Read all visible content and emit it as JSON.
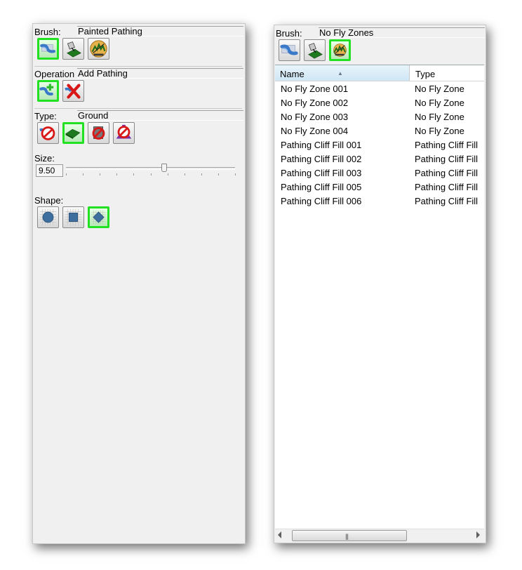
{
  "left_panel": {
    "brush": {
      "label": "Brush:",
      "value": "Painted Pathing"
    },
    "operation": {
      "label": "Operation",
      "value": "Add Pathing"
    },
    "type": {
      "label": "Type:",
      "value": "Ground"
    },
    "size": {
      "label": "Size:",
      "value": "9.50",
      "slider_fraction": 0.58
    },
    "shape": {
      "label": "Shape:"
    }
  },
  "right_panel": {
    "brush": {
      "label": "Brush:",
      "value": "No Fly Zones"
    },
    "list": {
      "columns": [
        "Name",
        "Type"
      ],
      "rows": [
        {
          "name": "No Fly Zone 001",
          "type": "No Fly Zone"
        },
        {
          "name": "No Fly Zone 002",
          "type": "No Fly Zone"
        },
        {
          "name": "No Fly Zone 003",
          "type": "No Fly Zone"
        },
        {
          "name": "No Fly Zone 004",
          "type": "No Fly Zone"
        },
        {
          "name": "Pathing Cliff Fill 001",
          "type": "Pathing Cliff Fill"
        },
        {
          "name": "Pathing Cliff Fill 002",
          "type": "Pathing Cliff Fill"
        },
        {
          "name": "Pathing Cliff Fill 003",
          "type": "Pathing Cliff Fill"
        },
        {
          "name": "Pathing Cliff Fill 005",
          "type": "Pathing Cliff Fill"
        },
        {
          "name": "Pathing Cliff Fill 006",
          "type": "Pathing Cliff Fill"
        }
      ],
      "scroll_grip": "|||"
    }
  },
  "colors": {
    "selected_border": "#22e022",
    "header_highlight": "#cfe6f5"
  }
}
